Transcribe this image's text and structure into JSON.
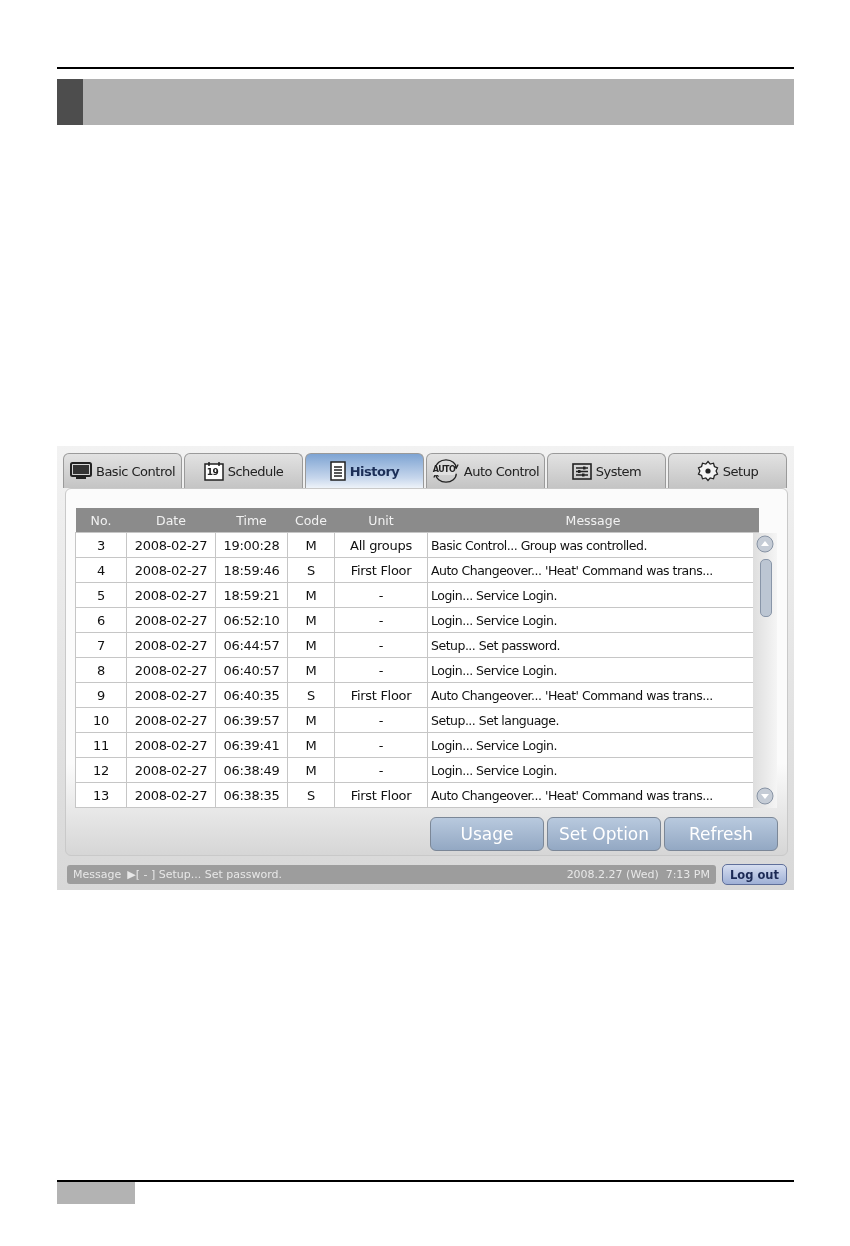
{
  "tabs": [
    {
      "label": "Basic Control",
      "kind": "monitor",
      "selected": false
    },
    {
      "label": "Schedule",
      "kind": "calendar",
      "badge": "19",
      "selected": false
    },
    {
      "label": "History",
      "kind": "list",
      "selected": true
    },
    {
      "label": "Auto Control",
      "kind": "auto",
      "badge": "AUTO",
      "selected": false
    },
    {
      "label": "System",
      "kind": "sliders",
      "selected": false
    },
    {
      "label": "Setup",
      "kind": "gear",
      "selected": false
    }
  ],
  "table": {
    "columns": [
      "No.",
      "Date",
      "Time",
      "Code",
      "Unit",
      "Message"
    ],
    "rows": [
      [
        "3",
        "2008-02-27",
        "19:00:28",
        "M",
        "All groups",
        "Basic Control... Group was controlled."
      ],
      [
        "4",
        "2008-02-27",
        "18:59:46",
        "S",
        "First Floor",
        "Auto Changeover... 'Heat' Command was trans..."
      ],
      [
        "5",
        "2008-02-27",
        "18:59:21",
        "M",
        "-",
        "Login... Service Login."
      ],
      [
        "6",
        "2008-02-27",
        "06:52:10",
        "M",
        "-",
        "Login... Service Login."
      ],
      [
        "7",
        "2008-02-27",
        "06:44:57",
        "M",
        "-",
        "Setup... Set password."
      ],
      [
        "8",
        "2008-02-27",
        "06:40:57",
        "M",
        "-",
        "Login... Service Login."
      ],
      [
        "9",
        "2008-02-27",
        "06:40:35",
        "S",
        "First Floor",
        "Auto Changeover... 'Heat' Command was trans..."
      ],
      [
        "10",
        "2008-02-27",
        "06:39:57",
        "M",
        "-",
        "Setup... Set language."
      ],
      [
        "11",
        "2008-02-27",
        "06:39:41",
        "M",
        "-",
        "Login... Service Login."
      ],
      [
        "12",
        "2008-02-27",
        "06:38:49",
        "M",
        "-",
        "Login... Service Login."
      ],
      [
        "13",
        "2008-02-27",
        "06:38:35",
        "S",
        "First Floor",
        "Auto Changeover... 'Heat' Command was trans..."
      ]
    ]
  },
  "buttons": [
    "Usage",
    "Set Option",
    "Refresh"
  ],
  "status_bar": {
    "label": "Message",
    "message": "▶[ - ] Setup... Set password.",
    "datetime": "2008.2.27 (Wed)  7:13 PM",
    "logout": "Log out"
  }
}
